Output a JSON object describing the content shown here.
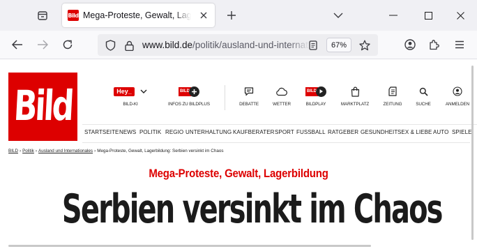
{
  "browser": {
    "tab": {
      "title": "Mega-Proteste, Gewalt, Lagerbildung",
      "favicon_text": "Bild"
    },
    "url": {
      "host": "www.bild.de",
      "path": "/politik/ausland-und-internationales/"
    },
    "zoom": "67%",
    "icons": {
      "tab_overview": "tab-overview-icon",
      "close_tab": "close-icon",
      "new_tab": "plus-icon",
      "list_tabs": "chevron-down-icon",
      "minimize": "minimize-icon",
      "maximize": "maximize-icon",
      "close_window": "close-icon",
      "back": "back-arrow-icon",
      "forward": "forward-arrow-icon",
      "reload": "reload-icon",
      "tracking": "shield-icon",
      "lock": "lock-icon",
      "reader": "reader-view-icon",
      "bookmark": "star-icon",
      "account": "account-icon",
      "extensions": "puzzle-icon",
      "menu": "hamburger-menu-icon"
    }
  },
  "site": {
    "logo_text": "Bild",
    "brand_color": "#dd0000",
    "services": [
      {
        "label": "BILD-KI",
        "badge": "Hey_"
      },
      {
        "label": "INFOS ZU BILDPLUS"
      },
      {
        "label": "DEBATTE"
      },
      {
        "label": "WETTER"
      },
      {
        "label": "BILDPLAY"
      },
      {
        "label": "MARKTPLATZ"
      },
      {
        "label": "ZEITUNG"
      },
      {
        "label": "SUCHE"
      },
      {
        "label": "ANMELDEN"
      }
    ],
    "nav": [
      "STARTSEITE",
      "NEWS",
      "POLITIK",
      "REGIO",
      "UNTERHALTUNG",
      "KAUFBERATER",
      "SPORT",
      "FUSSBALL",
      "RATGEBER",
      "GESUNDHEIT",
      "SEX & LIEBE",
      "AUTO",
      "SPIELE"
    ],
    "breadcrumb": [
      "BILD",
      "Politik",
      "Ausland und Internationales",
      "Mega-Proteste, Gewalt, Lagerbildung: Serbien versinkt im Chaos"
    ],
    "article": {
      "kicker": "Mega-Proteste, Gewalt, Lagerbildung",
      "headline": "Serbien versinkt im Chaos"
    }
  }
}
